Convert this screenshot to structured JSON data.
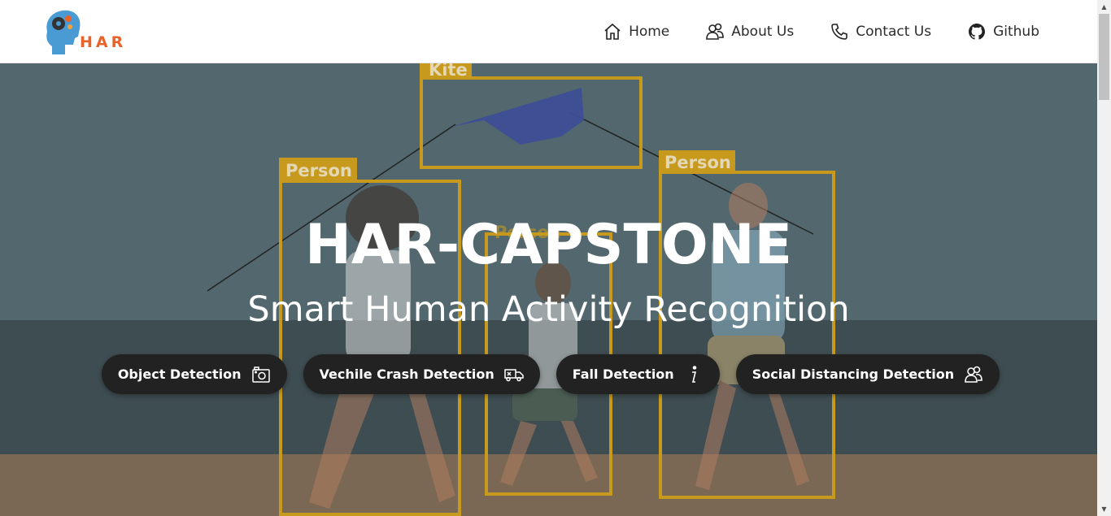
{
  "logo": {
    "text": "HAR",
    "icon": "head-gear-logo"
  },
  "nav": {
    "items": [
      {
        "label": "Home",
        "icon": "home-icon"
      },
      {
        "label": "About Us",
        "icon": "people-icon"
      },
      {
        "label": "Contact Us",
        "icon": "phone-icon"
      },
      {
        "label": "Github",
        "icon": "github-icon"
      }
    ]
  },
  "hero": {
    "title": "HAR-CAPSTONE",
    "subtitle": "Smart Human Activity Recognition",
    "detections": {
      "kite": "Kite",
      "person1": "Person",
      "person2": "Person",
      "person3": "Person"
    },
    "buttons": [
      {
        "label": "Object Detection",
        "icon": "camera-icon"
      },
      {
        "label": "Vechile Crash Detection",
        "icon": "truck-icon"
      },
      {
        "label": "Fall Detection",
        "icon": "info-icon"
      },
      {
        "label": "Social Distancing Detection",
        "icon": "people-icon"
      }
    ]
  },
  "colors": {
    "accent": "#e8622a",
    "box": "#c79a1e",
    "button_bg": "#222222",
    "sky": "#526a70",
    "sand": "#7d6a58"
  }
}
